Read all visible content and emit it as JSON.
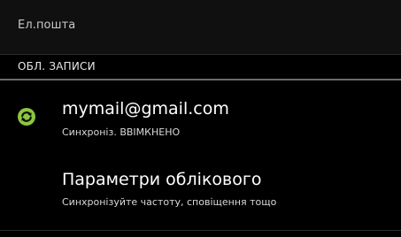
{
  "title_bar": {
    "title": "Ел.пошта"
  },
  "accounts_section": {
    "header": "ОБЛ. ЗАПИСИ",
    "account": {
      "email": "mymail@gmail.com",
      "sync_status": "Синхроніз. ВВІМКНЕНО",
      "icon": "sync-icon",
      "icon_color": "#8cc63f"
    },
    "settings": {
      "title": "Параметри облікового",
      "subtitle": "Синхронізуйте частоту, сповіщення тощо"
    }
  }
}
